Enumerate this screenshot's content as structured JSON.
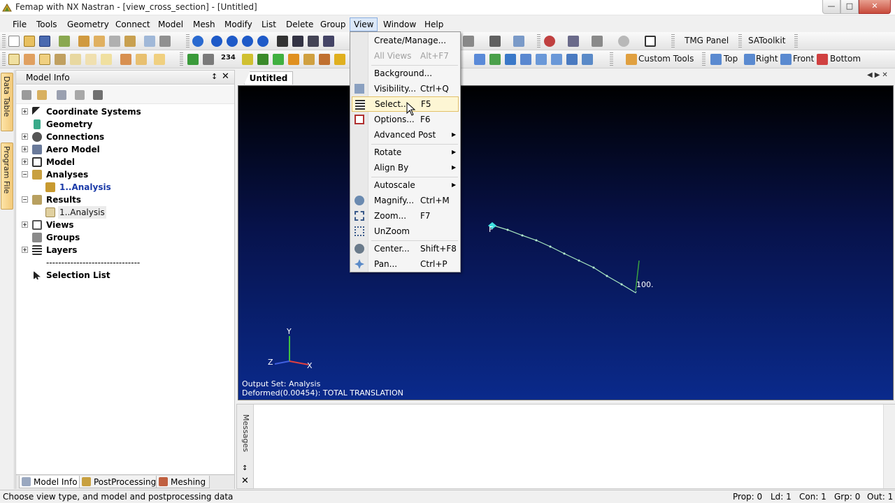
{
  "window": {
    "title": "Femap with NX Nastran - [view_cross_section] - [Untitled]",
    "minimize": "—",
    "maximize": "□",
    "close": "✕"
  },
  "menubar": [
    "File",
    "Tools",
    "Geometry",
    "Connect",
    "Model",
    "Mesh",
    "Modify",
    "List",
    "Delete",
    "Group",
    "View",
    "Window",
    "Help"
  ],
  "toolbar1": {
    "tmg_panel": "TMG Panel",
    "satoolkit": "SAToolkit"
  },
  "toolbar2": {
    "custom_tools": "Custom Tools",
    "top": "Top",
    "right": "Right",
    "front": "Front",
    "bottom": "Bottom",
    "counter": "234"
  },
  "side_tabs": {
    "data_table": "Data Table",
    "program_file": "Program File"
  },
  "model_info": {
    "title": "Model Info",
    "pin": "↕",
    "close": "✕",
    "tree": [
      {
        "label": "Coordinate Systems"
      },
      {
        "label": "Geometry"
      },
      {
        "label": "Connections"
      },
      {
        "label": "Aero Model"
      },
      {
        "label": "Model"
      },
      {
        "label": "Analyses"
      },
      {
        "label": "1..Analysis"
      },
      {
        "label": "Results"
      },
      {
        "label": "1..Analysis"
      },
      {
        "label": "Views"
      },
      {
        "label": "Groups"
      },
      {
        "label": "Layers"
      },
      {
        "label": "-------------------------------"
      },
      {
        "label": "Selection List"
      }
    ],
    "tabs": [
      "Model Info",
      "PostProcessing",
      "Meshing"
    ]
  },
  "document_tab": "Untitled",
  "graphics": {
    "node_label_start": "F",
    "node_label_end": "100.",
    "axis_x": "X",
    "axis_y": "Y",
    "axis_z": "Z",
    "output_set": "Output Set: Analysis",
    "deformed": "Deformed(0.00454): TOTAL TRANSLATION",
    "colors": {
      "background_top": "#000000",
      "background_bottom": "#0a2a8c",
      "curve": "#a8e8c0"
    }
  },
  "messages": {
    "label": "Messages",
    "pin": "↕",
    "close": "✕"
  },
  "status": {
    "text": "Choose view type, and model and postprocessing data",
    "prop": "Prop: 0",
    "ld": "Ld: 1",
    "con": "Con: 1",
    "grp": "Grp: 0",
    "out": "Out: 1"
  },
  "view_menu": {
    "items": [
      {
        "label": "Create/Manage...",
        "shortcut": "",
        "disabled": false,
        "submenu": false
      },
      {
        "label": "All Views",
        "shortcut": "Alt+F7",
        "disabled": true,
        "submenu": false
      },
      {
        "label": "Background...",
        "shortcut": "",
        "disabled": false,
        "submenu": false
      },
      {
        "label": "Visibility...",
        "shortcut": "Ctrl+Q",
        "disabled": false,
        "submenu": false
      },
      {
        "label": "Select...",
        "shortcut": "F5",
        "disabled": false,
        "submenu": false,
        "highlighted": true
      },
      {
        "label": "Options...",
        "shortcut": "F6",
        "disabled": false,
        "submenu": false
      },
      {
        "label": "Advanced Post",
        "shortcut": "",
        "disabled": false,
        "submenu": true
      },
      {
        "label": "Rotate",
        "shortcut": "",
        "disabled": false,
        "submenu": true
      },
      {
        "label": "Align By",
        "shortcut": "",
        "disabled": false,
        "submenu": true
      },
      {
        "label": "Autoscale",
        "shortcut": "",
        "disabled": false,
        "submenu": true
      },
      {
        "label": "Magnify...",
        "shortcut": "Ctrl+M",
        "disabled": false,
        "submenu": false
      },
      {
        "label": "Zoom...",
        "shortcut": "F7",
        "disabled": false,
        "submenu": false
      },
      {
        "label": "UnZoom",
        "shortcut": "",
        "disabled": false,
        "submenu": false
      },
      {
        "label": "Center...",
        "shortcut": "Shift+F8",
        "disabled": false,
        "submenu": false
      },
      {
        "label": "Pan...",
        "shortcut": "Ctrl+P",
        "disabled": false,
        "submenu": false
      }
    ],
    "submenu_arrow": "▶"
  }
}
